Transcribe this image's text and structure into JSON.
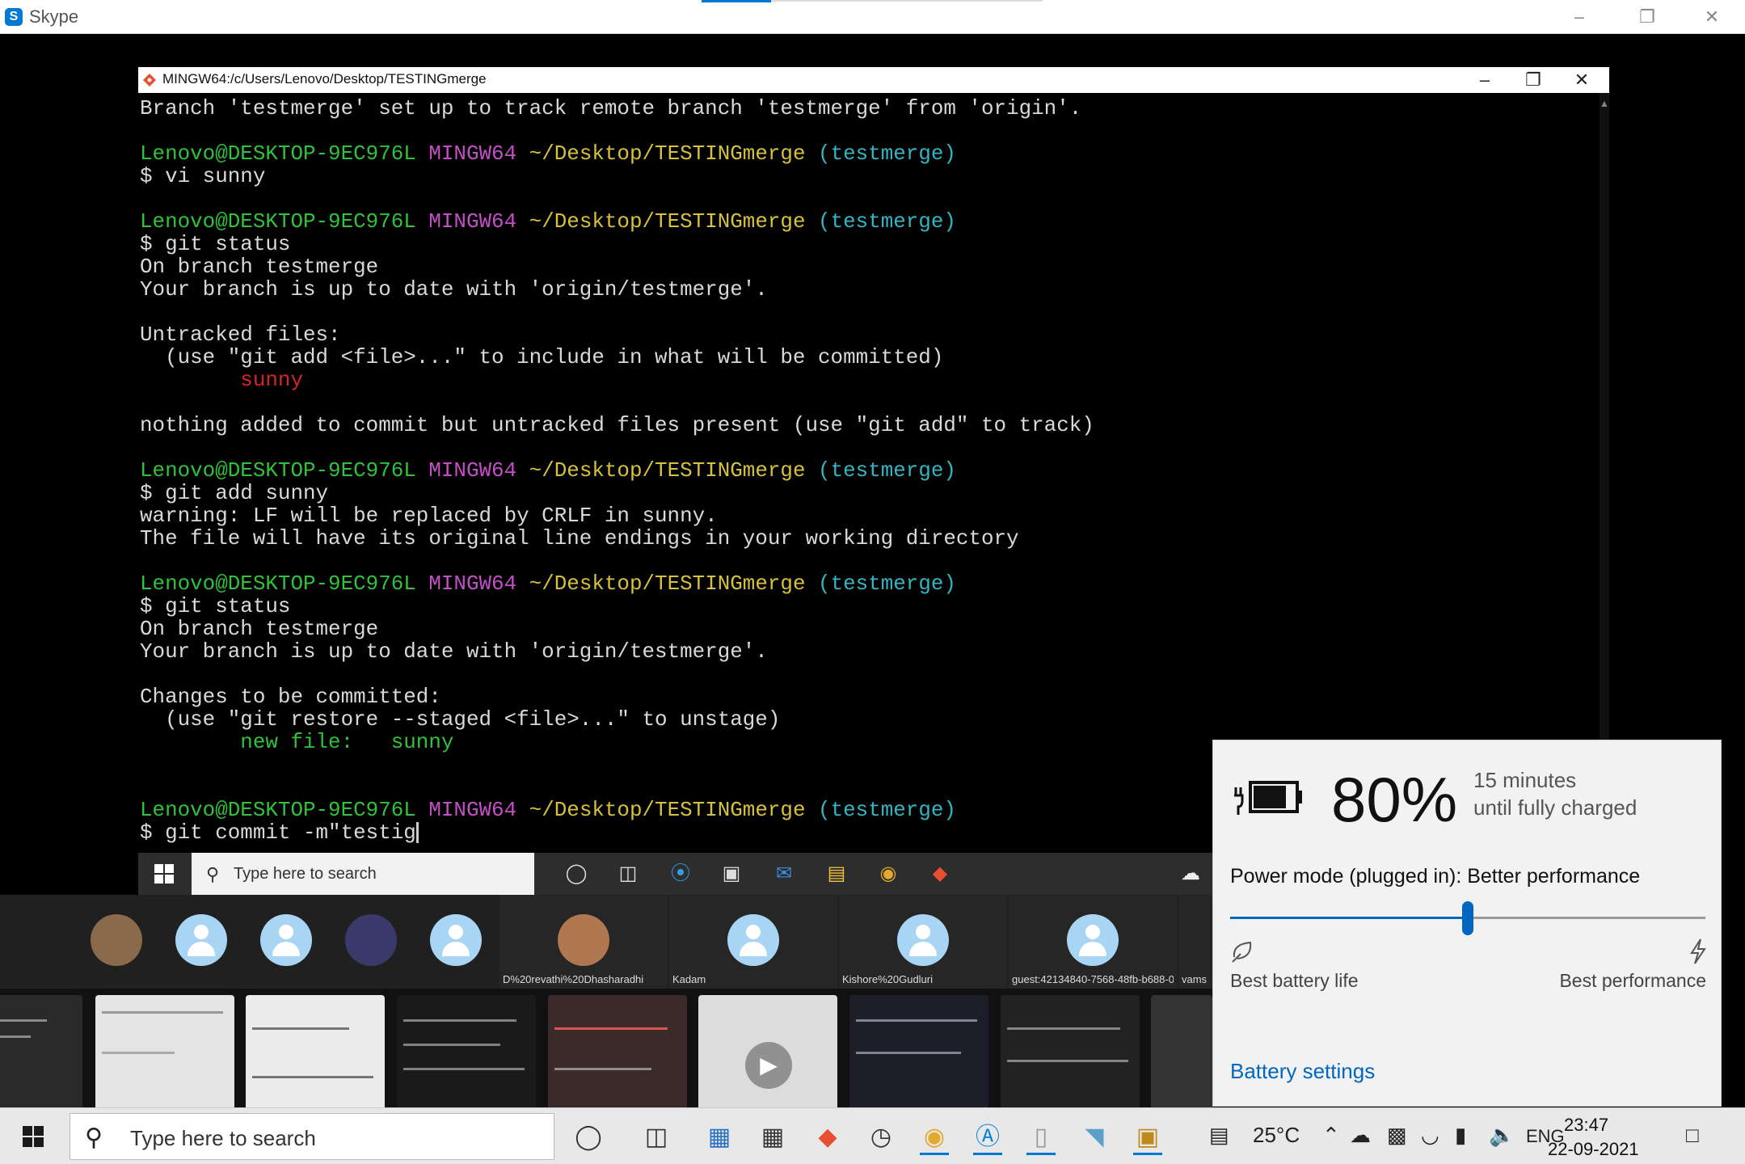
{
  "skype": {
    "title": "Skype",
    "logo": "S"
  },
  "terminal": {
    "title": "MINGW64:/c/Users/Lenovo/Desktop/TESTINGmerge",
    "prompt": {
      "user": "Lenovo@DESKTOP-9EC976L",
      "env": "MINGW64",
      "path": "~/Desktop/TESTINGmerge",
      "branch": "(testmerge)"
    },
    "lines": {
      "l0": "Branch 'testmerge' set up to track remote branch 'testmerge' from 'origin'.",
      "l3": "$ vi sunny",
      "l6": "$ git status",
      "l7": "On branch testmerge",
      "l8": "Your branch is up to date with 'origin/testmerge'.",
      "l10": "Untracked files:",
      "l11": "  (use \"git add <file>...\" to include in what will be committed)",
      "l12": "        sunny",
      "l14": "nothing added to commit but untracked files present (use \"git add\" to track)",
      "l17": "$ git add sunny",
      "l18": "warning: LF will be replaced by CRLF in sunny.",
      "l19": "The file will have its original line endings in your working directory",
      "l22": "$ git status",
      "l23": "On branch testmerge",
      "l24": "Your branch is up to date with 'origin/testmerge'.",
      "l26": "Changes to be committed:",
      "l27": "  (use \"git restore --staged <file>...\" to unstage)",
      "l28": "        new file:   sunny",
      "l32": "$ git commit -m\"testig"
    }
  },
  "inner_taskbar": {
    "search_placeholder": "Type here to search"
  },
  "participants": [
    {
      "name": "D%20revathi%20Dhasharadhi"
    },
    {
      "name": "Kadam"
    },
    {
      "name": "Kishore%20Gudluri"
    },
    {
      "name": "guest:42134840-7568-48fb-b688-0..."
    },
    {
      "name": "vams"
    }
  ],
  "battery": {
    "percent": "80%",
    "level": 0.8,
    "eta_line1": "15 minutes",
    "eta_line2": "until fully charged",
    "power_mode": "Power mode (plugged in): Better performance",
    "slider_fraction": 0.5,
    "left_label": "Best battery life",
    "right_label": "Best performance",
    "settings_link": "Battery settings"
  },
  "taskbar": {
    "search_placeholder": "Type here to search",
    "temperature": "25°C",
    "language": "ENG",
    "time": "23:47",
    "date": "22-09-2021"
  },
  "colors": {
    "accent": "#0067c0",
    "prompt_green": "#2fc23a",
    "prompt_magenta": "#c34ec6",
    "prompt_yellow": "#d7c13a",
    "prompt_cyan": "#33b5c3",
    "untracked_red": "#d52525"
  }
}
